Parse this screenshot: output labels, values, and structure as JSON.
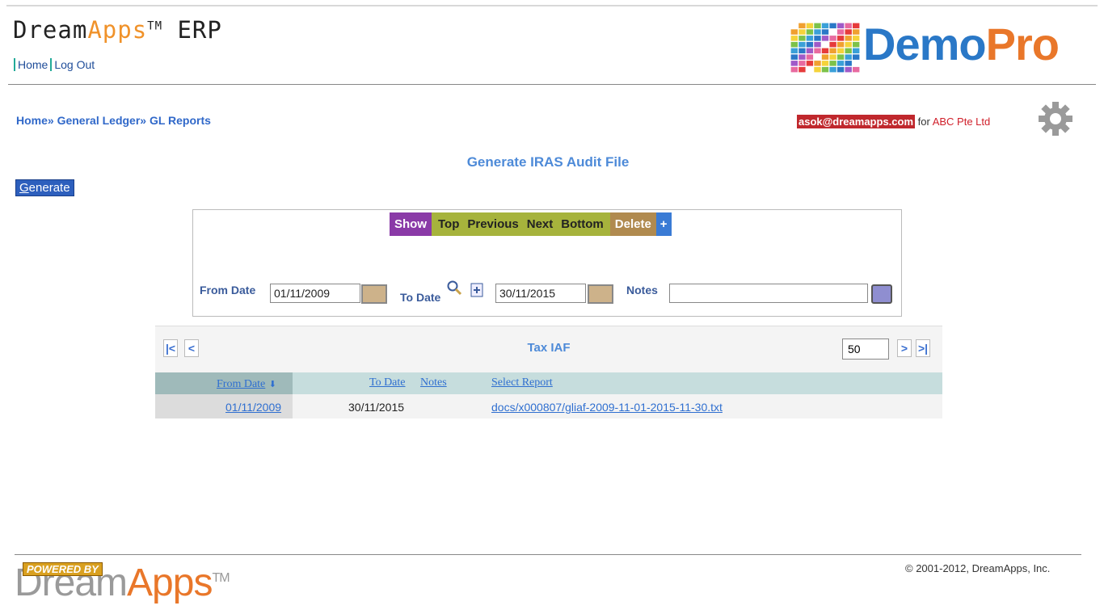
{
  "header": {
    "brand_prefix": "Dream",
    "brand_apps": "Apps",
    "brand_tm": "TM",
    "brand_suffix": " ERP",
    "links": [
      "Home",
      "Log Out"
    ],
    "logo_demo": "Demo",
    "logo_pro": "Pro"
  },
  "breadcrumb": "Home» General Ledger» GL Reports",
  "user": {
    "email": "asok@dreamapps.com",
    "for": " for ",
    "company": "ABC Pte Ltd"
  },
  "page_title": "Generate IRAS Audit File",
  "generate_label_first": "G",
  "generate_label_rest": "enerate",
  "toolbar": {
    "show": "Show",
    "top": "Top",
    "previous": "Previous",
    "next": "Next",
    "bottom": "Bottom",
    "delete": "Delete",
    "plus": "+"
  },
  "form": {
    "from_date_label": "From Date",
    "from_date_value": "01/11/2009",
    "to_date_label": "To Date",
    "to_date_value": "30/11/2015",
    "notes_label": "Notes",
    "notes_value": ""
  },
  "grid": {
    "title": "Tax IAF",
    "first": "|<",
    "prev": "<",
    "next": ">",
    "last": ">|",
    "page_size": "50",
    "columns": [
      "From Date",
      "To Date",
      "Notes",
      "Select Report"
    ],
    "sort_indicator": "⬇",
    "rows": [
      {
        "from_date": "01/11/2009",
        "to_date": "30/11/2015",
        "notes": "",
        "report": "docs/x000807/gliaf-2009-11-01-2015-11-30.txt"
      }
    ]
  },
  "footer": {
    "powered_by": "POWERED BY",
    "dream": "Dream",
    "apps": "Apps",
    "tm": "TM",
    "copyright": "© 2001-2012, DreamApps, Inc."
  },
  "colors": {
    "accent_blue": "#4d8ad8",
    "show": "#8a3aa7",
    "nav": "#a6b33c",
    "delete": "#b08a4f",
    "user_badge": "#c0282d"
  },
  "icons": [
    "search-icon",
    "add-icon",
    "calendar-icon",
    "notes-icon",
    "gear-icon",
    "sort-down-icon"
  ]
}
